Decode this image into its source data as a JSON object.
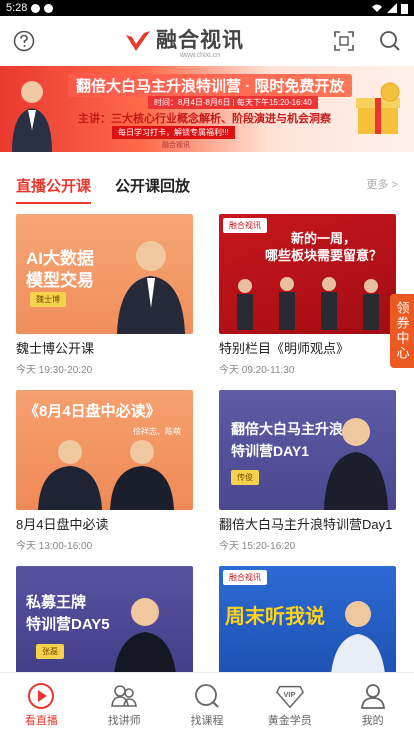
{
  "status": {
    "time": "5:28"
  },
  "header": {
    "logo_text": "融合视讯",
    "logo_sub": "www.chixi.cn"
  },
  "banner": {
    "title": "翻倍大白马主升浪特训营 · 限时免费开放",
    "info": "时间：8月4日-8月6日  |  每天下午15:20-16:40",
    "speaker": "主讲：三大核心行业概念解析、阶段演进与机会洞察",
    "slogan": "每日学习打卡，解锁专属福利!!!",
    "footer": "融合视讯"
  },
  "tabs": [
    {
      "label": "直播公开课",
      "active": true
    },
    {
      "label": "公开课回放",
      "active": false
    }
  ],
  "more_label": "更多 >",
  "cards": [
    {
      "title": "魏士博公开课",
      "time": "今天 19:30-20:20",
      "thumb_text": "AI大数据\n模型交易",
      "tag": "魏士博"
    },
    {
      "title": "特别栏目《明师观点》",
      "time": "今天 09:20-11:30",
      "thumb_text": "新的一周，\n哪些板块需要留意？",
      "tag": "融合视讯"
    },
    {
      "title": "8月4日盘中必读",
      "time": "今天 13:00-16:00",
      "thumb_text": "《8月4日盘中必读》",
      "tag": "徐祥志、陈萌"
    },
    {
      "title": "翻倍大白马主升浪特训营Day1",
      "time": "今天 15:20-16:20",
      "thumb_text": "翻倍大白马主升浪\n特训营DAY1",
      "tag": "传俊"
    },
    {
      "title": "",
      "time": "",
      "thumb_text": "私募王牌\n特训营DAY5",
      "tag": "张磊"
    },
    {
      "title": "",
      "time": "",
      "thumb_text": "周末听我说",
      "tag": "融合视讯"
    }
  ],
  "side_float": "领券中心",
  "nav": [
    {
      "label": "看直播",
      "active": true,
      "icon": "play-icon"
    },
    {
      "label": "找讲师",
      "active": false,
      "icon": "teacher-icon"
    },
    {
      "label": "找课程",
      "active": false,
      "icon": "course-icon"
    },
    {
      "label": "黄金学员",
      "active": false,
      "icon": "vip-icon"
    },
    {
      "label": "我的",
      "active": false,
      "icon": "profile-icon"
    }
  ],
  "colors": {
    "accent": "#e8382f",
    "side": "#ea5a22"
  }
}
